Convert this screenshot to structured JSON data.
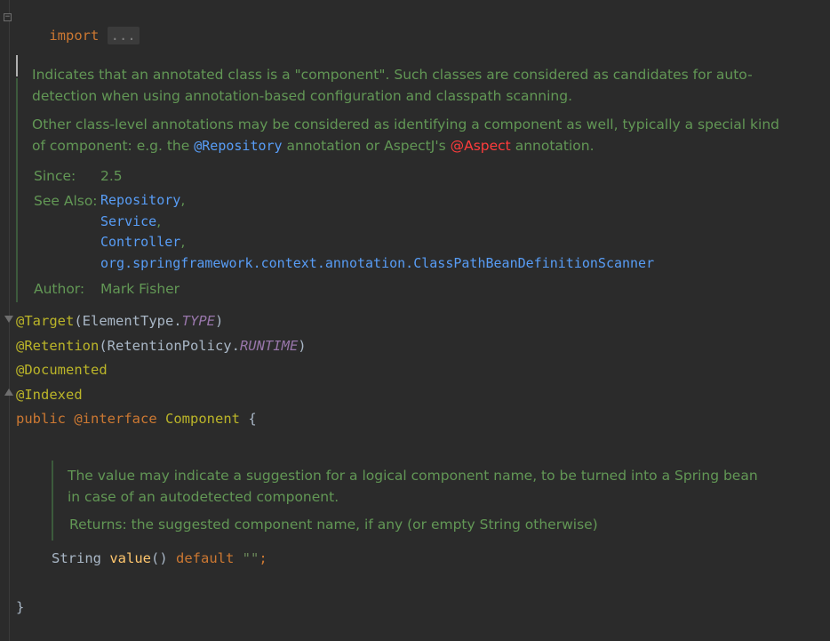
{
  "import_line": {
    "keyword": "import",
    "folded": "..."
  },
  "component_doc": {
    "para1_a": "Indicates that an annotated class is a \"component\". Such classes are considered as candidates for auto-",
    "para1_b": "detection when using annotation-based configuration and classpath scanning.",
    "para2_a": "Other class-level annotations may be considered as identifying a component as well, typically a special kind",
    "para2_b_prefix": "of component: e.g. the ",
    "para2_b_link1": "@Repository",
    "para2_b_mid": " annotation or AspectJ's ",
    "para2_b_link2": "@Aspect",
    "para2_b_suffix": " annotation.",
    "since_label": "Since:",
    "since_value": "2.5",
    "see_also_label": "See Also:",
    "see_also": [
      "Repository",
      "Service",
      "Controller",
      "org.springframework.context.annotation.ClassPathBeanDefinitionScanner"
    ],
    "see_also_sep": ",",
    "author_label": "Author:",
    "author_value": "Mark Fisher"
  },
  "annotations": {
    "target_name": "@Target",
    "target_open": "(ElementType.",
    "target_const": "TYPE",
    "target_close": ")",
    "retention_name": "@Retention",
    "retention_open": "(RetentionPolicy.",
    "retention_const": "RUNTIME",
    "retention_close": ")",
    "documented": "@Documented",
    "indexed": "@Indexed"
  },
  "declaration": {
    "public_kw": "public",
    "interface_kw": "@interface",
    "name": "Component",
    "open_brace": " {"
  },
  "value_doc": {
    "line1": "The value may indicate a suggestion for a logical component name, to be turned into a Spring bean",
    "line2": "in case of an autodetected component.",
    "returns": "Returns: the suggested component name, if any (or empty String otherwise)"
  },
  "method": {
    "type": "String ",
    "name": "value",
    "parens": "() ",
    "default_kw": "default",
    "default_val": " \"\"",
    "semi": ";"
  },
  "closing_brace": "}",
  "colors": {
    "background": "#2b2b2b",
    "keyword": "#cc7832",
    "annotation": "#bbb529",
    "constant": "#9876aa",
    "doc_text": "#629755",
    "link": "#589df6",
    "aspect_link": "#ff3c3c"
  }
}
